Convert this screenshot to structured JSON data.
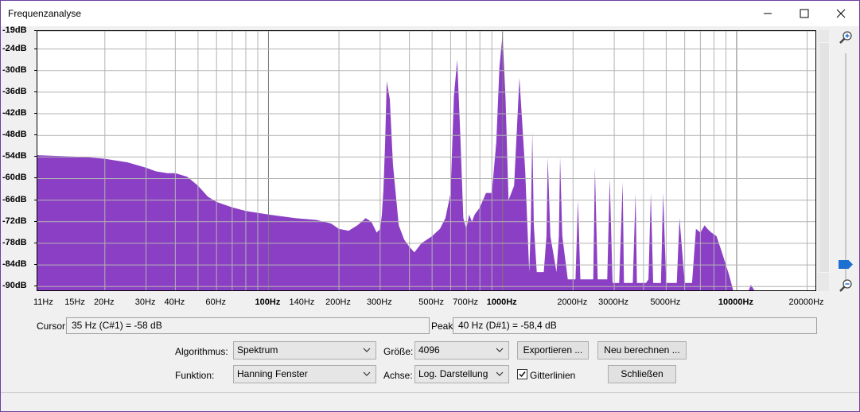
{
  "window": {
    "title": "Frequenzanalyse",
    "minimize_icon": "minimize-icon",
    "maximize_icon": "maximize-icon",
    "close_icon": "close-icon"
  },
  "plot": {
    "fill_color": "#8b3fc4",
    "y_labels": [
      "-19dB",
      "-24dB",
      "-30dB",
      "-36dB",
      "-42dB",
      "-48dB",
      "-54dB",
      "-60dB",
      "-66dB",
      "-72dB",
      "-78dB",
      "-84dB",
      "-90dB"
    ],
    "x_labels": [
      {
        "text": "11Hz",
        "hz": 11,
        "bold": false
      },
      {
        "text": "15Hz",
        "hz": 15,
        "bold": false
      },
      {
        "text": "20Hz",
        "hz": 20,
        "bold": false
      },
      {
        "text": "30Hz",
        "hz": 30,
        "bold": false
      },
      {
        "text": "40Hz",
        "hz": 40,
        "bold": false
      },
      {
        "text": "60Hz",
        "hz": 60,
        "bold": false
      },
      {
        "text": "100Hz",
        "hz": 100,
        "bold": true
      },
      {
        "text": "140Hz",
        "hz": 140,
        "bold": false
      },
      {
        "text": "200Hz",
        "hz": 200,
        "bold": false
      },
      {
        "text": "300Hz",
        "hz": 300,
        "bold": false
      },
      {
        "text": "500Hz",
        "hz": 500,
        "bold": false
      },
      {
        "text": "700Hz",
        "hz": 700,
        "bold": false
      },
      {
        "text": "1000Hz",
        "hz": 1000,
        "bold": true
      },
      {
        "text": "2000Hz",
        "hz": 2000,
        "bold": false
      },
      {
        "text": "3000Hz",
        "hz": 3000,
        "bold": false
      },
      {
        "text": "5000Hz",
        "hz": 5000,
        "bold": false
      },
      {
        "text": "10000Hz",
        "hz": 10000,
        "bold": true
      },
      {
        "text": "20000Hz",
        "hz": 20000,
        "bold": false
      }
    ],
    "zoom_in_icon": "zoom-in-icon",
    "zoom_out_icon": "zoom-out-icon"
  },
  "chart_data": {
    "type": "area",
    "x_scale": "log",
    "xlim": [
      10.3,
      22050
    ],
    "ylim": [
      -91.5,
      -19
    ],
    "grid": true,
    "x_hz": [
      10.3,
      16,
      20,
      25,
      30,
      33,
      37,
      40,
      45,
      50,
      55,
      60,
      70,
      80,
      100,
      130,
      160,
      185,
      200,
      220,
      240,
      250,
      260,
      275,
      290,
      300,
      305,
      310,
      315,
      320,
      330,
      340,
      360,
      380,
      400,
      420,
      450,
      500,
      540,
      570,
      600,
      620,
      640,
      660,
      680,
      700,
      720,
      740,
      760,
      800,
      850,
      900,
      940,
      970,
      1000,
      1030,
      1060,
      1120,
      1180,
      1250,
      1300,
      1320,
      1340,
      1360,
      1400,
      1500,
      1540,
      1560,
      1600,
      1700,
      1740,
      1760,
      1800,
      1900,
      2050,
      2100,
      2150,
      2300,
      2440,
      2480,
      2550,
      2700,
      2800,
      2870,
      2950,
      3150,
      3260,
      3300,
      3400,
      3600,
      3700,
      3750,
      3850,
      4100,
      4200,
      4300,
      4400,
      4600,
      4750,
      4850,
      5000,
      5250,
      5450,
      5550,
      5700,
      6000,
      6300,
      6450,
      6700,
      7000,
      7300,
      7500,
      7800,
      8200,
      8600,
      9000,
      9300,
      9700,
      10000,
      10500,
      10800,
      11000,
      11200,
      11500,
      12000,
      14000,
      18000,
      22050
    ],
    "y_db": [
      -53.5,
      -54,
      -54.5,
      -55.5,
      -57,
      -58,
      -58.5,
      -58.5,
      -59.5,
      -62,
      -65,
      -66.5,
      -68,
      -69,
      -70,
      -71,
      -71.5,
      -72.5,
      -74,
      -74.5,
      -73,
      -72,
      -71,
      -72,
      -75,
      -74,
      -70,
      -63,
      -50,
      -33,
      -38,
      -56,
      -73,
      -77,
      -79,
      -80.5,
      -78,
      -76,
      -74,
      -71,
      -64,
      -37,
      -27,
      -48,
      -71,
      -74,
      -70,
      -72,
      -70,
      -68,
      -64,
      -64,
      -50,
      -29,
      -20,
      -38,
      -66,
      -62,
      -32,
      -58,
      -86,
      -73,
      -47,
      -73,
      -86,
      -86,
      -76,
      -54,
      -76,
      -86,
      -76,
      -54,
      -76,
      -88,
      -88,
      -66,
      -88,
      -88,
      -88,
      -57,
      -88,
      -88,
      -88,
      -60,
      -89,
      -89,
      -61,
      -89,
      -89,
      -89,
      -64,
      -89,
      -89,
      -89,
      -88,
      -64,
      -89,
      -89,
      -89,
      -64,
      -89,
      -89,
      -89,
      -89,
      -71,
      -89,
      -89,
      -89,
      -74,
      -75,
      -73,
      -74,
      -75,
      -76,
      -80,
      -84,
      -87,
      -91.5,
      -91.5,
      -91.5,
      -91.5,
      -91.5,
      -91.5,
      -89.5,
      -91.5,
      -91.5,
      -91.5,
      -91.5,
      -91.5
    ]
  },
  "cursor": {
    "label": "Cursor:",
    "value": "35 Hz (C#1) = -58 dB"
  },
  "peak": {
    "label": "Peak:",
    "value": "40 Hz (D#1) = -58,4 dB"
  },
  "controls": {
    "algorithm_label": "Algorithmus:",
    "algorithm_value": "Spektrum",
    "function_label": "Funktion:",
    "function_value": "Hanning Fenster",
    "size_label": "Größe:",
    "size_value": "4096",
    "axis_label": "Achse:",
    "axis_value": "Log. Darstellung",
    "export_button": "Exportieren ...",
    "recalc_button": "Neu berechnen ...",
    "grid_checkbox_label": "Gitterlinien",
    "grid_checked": true,
    "close_button": "Schließen"
  }
}
